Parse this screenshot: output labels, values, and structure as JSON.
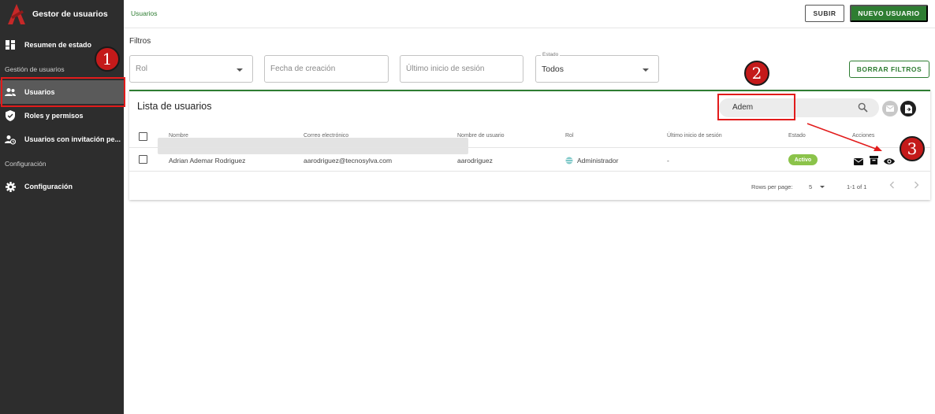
{
  "app": {
    "title": "Gestor de usuarios"
  },
  "sidebar": {
    "items": [
      {
        "label": "Resumen de estado",
        "icon": "dashboard-icon"
      },
      {
        "label": "Usuarios",
        "icon": "users-icon"
      },
      {
        "label": "Roles y permisos",
        "icon": "shield-icon"
      },
      {
        "label": "Usuarios con invitación pe...",
        "icon": "user-invite-icon"
      },
      {
        "label": "Configuración",
        "icon": "gear-icon"
      }
    ],
    "sections": {
      "user_management": "Gestión de usuarios",
      "configuration": "Configuración"
    }
  },
  "header": {
    "breadcrumb": "Usuarios",
    "upload_label": "SUBIR",
    "new_user_label": "NUEVO USUARIO"
  },
  "filters": {
    "title": "Filtros",
    "role_placeholder": "Rol",
    "created_placeholder": "Fecha de creación",
    "last_login_placeholder": "Último inicio de sesión",
    "status_legend": "Estado",
    "status_value": "Todos",
    "clear_label": "BORRAR FILTROS"
  },
  "user_list": {
    "title": "Lista de usuarios",
    "search_value": "Adem",
    "columns": [
      "Nombre",
      "Correo electrónico",
      "Nombre de usuario",
      "Rol",
      "Último inicio de sesión",
      "Estado",
      "Acciones"
    ],
    "rows": [
      {
        "name": "Adrian Ademar Rodriguez",
        "email": "aarodriguez@tecnosylva.com",
        "username": "aarodriguez",
        "role": "Administrador",
        "last_login": "-",
        "status": "Activo"
      }
    ],
    "pagination": {
      "rows_per_page_label": "Rows per page:",
      "rows_per_page": "5",
      "range": "1-1 of 1"
    }
  },
  "annotations": {
    "steps": [
      "1",
      "2",
      "3"
    ]
  },
  "colors": {
    "accent": "#2e7d32",
    "sidebar": "#2d2d2d",
    "highlight": "#e21b1b",
    "status_active": "#8bc34a"
  }
}
